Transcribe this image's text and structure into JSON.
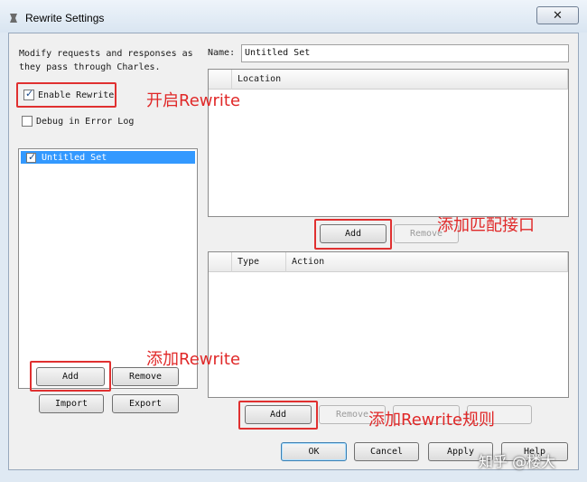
{
  "window": {
    "title": "Rewrite Settings",
    "close_label": "✕"
  },
  "left": {
    "description": "Modify requests and responses as\nthey pass through Charles.",
    "enable_rewrite": {
      "label": "Enable Rewrite",
      "checked": true
    },
    "debug_log": {
      "label": "Debug in Error Log",
      "checked": false
    },
    "sets": [
      {
        "name": "Untitled Set",
        "checked": true
      }
    ],
    "buttons": {
      "add": "Add",
      "remove": "Remove",
      "import": "Import",
      "export": "Export"
    }
  },
  "right": {
    "name_label": "Name:",
    "name_value": "Untitled Set",
    "location_header": "Location",
    "location_buttons": {
      "add": "Add",
      "remove": "Remove"
    },
    "rules_headers": {
      "type": "Type",
      "action": "Action"
    },
    "rules_buttons": {
      "add": "Add",
      "remove": "Remove"
    }
  },
  "footer": {
    "ok": "OK",
    "cancel": "Cancel",
    "apply": "Apply",
    "help": "Help"
  },
  "annotations": {
    "enable": "开启Rewrite",
    "location": "添加匹配接口",
    "add_set": "添加Rewrite",
    "add_rule": "添加Rewrite规则"
  },
  "watermark": "知乎 @楼大",
  "colors": {
    "annotation": "#e02828",
    "selection": "#3399ff"
  }
}
